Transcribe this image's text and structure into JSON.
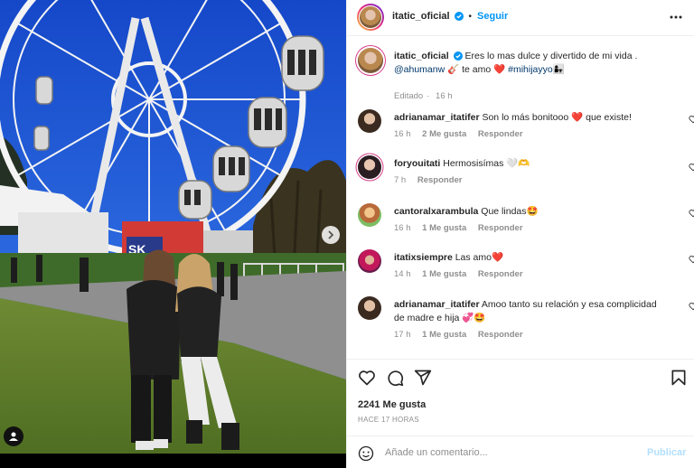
{
  "post": {
    "author": "itatic_oficial",
    "follow_label": "Seguir",
    "dot": "•"
  },
  "caption": {
    "username": "itatic_oficial",
    "text_1": "Eres lo mas dulce y divertido de mi vida .",
    "mention": "@ahumanw",
    "text_2": "🎸 te amo ❤️",
    "hashtag": "#mihijayyo",
    "text_3": "👩‍👧",
    "meta_edited": "Editado",
    "meta_time": "16 h"
  },
  "comments": [
    {
      "username": "adrianamar_itatifer",
      "text": "Son lo más bonitooo ❤️ que existe!",
      "time": "16 h",
      "likes": "2 Me gusta",
      "reply": "Responder"
    },
    {
      "username": "foryouitati",
      "text": "Hermosisímas 🤍🫶",
      "time": "7 h",
      "likes": "",
      "reply": "Responder"
    },
    {
      "username": "cantoralxarambula",
      "text": "Que lindas🤩",
      "time": "16 h",
      "likes": "1 Me gusta",
      "reply": "Responder"
    },
    {
      "username": "itatixsiempre",
      "text": "Las amo❤️",
      "time": "14 h",
      "likes": "1 Me gusta",
      "reply": "Responder"
    },
    {
      "username": "adrianamar_itatifer",
      "text": "Amoo tanto su relación y esa complicidad de madre e hija 💞🤩",
      "time": "17 h",
      "likes": "1 Me gusta",
      "reply": "Responder"
    }
  ],
  "engagement": {
    "likes": "2241 Me gusta",
    "posted": "HACE 17 HORAS"
  },
  "composer": {
    "placeholder": "Añade un comentario...",
    "publish_label": "Publicar"
  },
  "photo": {
    "sign_text": "SK"
  },
  "colors": {
    "accent": "#0095f6",
    "publish_disabled": "#b2dffc",
    "verified": "#0095f6",
    "like_red": "#ed4956"
  },
  "icons": [
    "verified-icon",
    "more-icon",
    "heart-icon",
    "comment-icon",
    "share-icon",
    "bookmark-icon",
    "emoji-icon",
    "next-arrow-icon",
    "user-tag-icon"
  ]
}
